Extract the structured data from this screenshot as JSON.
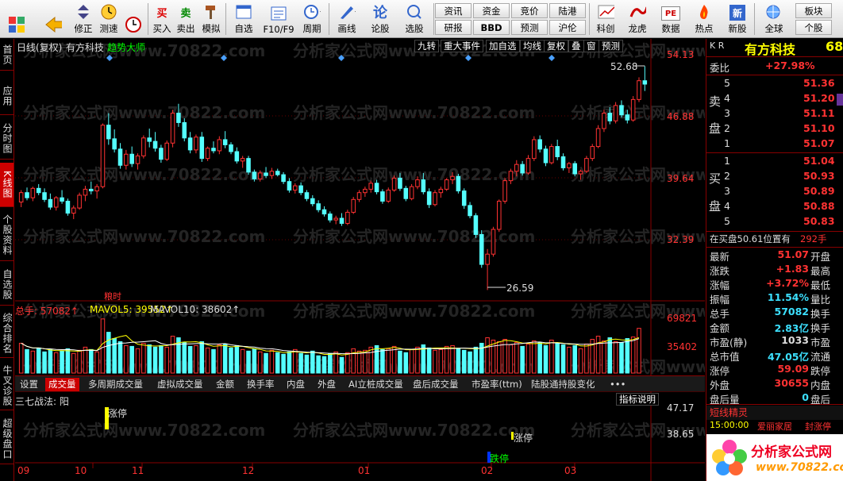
{
  "toolbar": {
    "buttons": [
      {
        "label": "",
        "icon": "grid-icon"
      },
      {
        "label": "",
        "icon": "back-arrow-icon"
      },
      {
        "label": "修正",
        "icon": "up-arrow-icon"
      },
      {
        "label": "测速",
        "icon": "clock-icon"
      },
      {
        "label": "买入",
        "icon": "buy-icon"
      },
      {
        "label": "卖出",
        "icon": "sell-icon"
      },
      {
        "label": "模拟",
        "icon": "hammer-icon"
      },
      {
        "label": "自选",
        "icon": "favorites-icon"
      },
      {
        "label": "F10/F9",
        "icon": "f10-icon"
      },
      {
        "label": "周期",
        "icon": "cycle-icon"
      },
      {
        "label": "画线",
        "icon": "pen-icon"
      },
      {
        "label": "论股",
        "icon": "discuss-icon"
      },
      {
        "label": "选股",
        "icon": "select-icon"
      },
      {
        "label": "科创",
        "icon": "kechuang-icon"
      },
      {
        "label": "龙虎",
        "icon": "dragon-icon"
      },
      {
        "label": "数据",
        "icon": "data-icon"
      },
      {
        "label": "热点",
        "icon": "hot-icon"
      },
      {
        "label": "新股",
        "icon": "ipo-icon"
      },
      {
        "label": "全球",
        "icon": "globe-icon"
      }
    ],
    "small_top": [
      "资讯",
      "资金",
      "竞价",
      "陆港",
      "板块"
    ],
    "small_bottom": [
      "研报",
      "BBD",
      "预测",
      "沪伦",
      "个股"
    ],
    "sell_glyph": "卖",
    "buy_glyph": "买",
    "lun_glyph": "论",
    "pe_glyph": "PE",
    "new_glyph": "新"
  },
  "sidebar": {
    "tabs": [
      "首页",
      "应用",
      "分时图",
      "K线图",
      "个股资料",
      "自选股",
      "综合排名",
      "牛叉诊股",
      "超级盘口"
    ]
  },
  "chart": {
    "period": "日线(复权)",
    "stock_name": "有方科技",
    "indicator": "趋势大师",
    "buttons": [
      "九转",
      "重大事件",
      "加自选",
      "均线",
      "复权",
      "叠",
      "窗",
      "预测"
    ],
    "price_labels": [
      "54.13",
      "46.88",
      "39.64",
      "32.39"
    ],
    "high_label": "52.68",
    "low_label": "26.59",
    "event_label": "粮时",
    "volume_header": {
      "total": "总手: 57082↑",
      "ma5": "MAVOL5: 39552↑",
      "ma10": "MAVOL10: 38602↑"
    },
    "volume_labels": [
      "69821",
      "35402"
    ],
    "tabs": [
      "设置",
      "成交量",
      "多周期成交量",
      "虚拟成交量",
      "金额",
      "换手率",
      "内盘",
      "外盘",
      "AI立桩成交量",
      "盘后成交量",
      "市盈率(ttm)",
      "陆股通持股变化",
      "•••"
    ],
    "indicator_button": "指标说明",
    "sub_title": "三七战法: 阳",
    "sub_labels": [
      "47.17",
      "38.65"
    ],
    "zt1": "涨停",
    "zt2": "涨停",
    "dt": "跌停",
    "months": [
      "09",
      "10",
      "11",
      "12",
      "01",
      "02",
      "03"
    ],
    "watermark": "分析家公式网www.70822.com"
  },
  "chart_data": {
    "type": "candlestick",
    "ylim": [
      26,
      55
    ],
    "candles": [
      [
        36.8,
        38.2,
        36.2,
        37.9
      ],
      [
        37.9,
        38.5,
        37.0,
        37.3
      ],
      [
        37.3,
        38.6,
        36.9,
        38.4
      ],
      [
        38.4,
        38.9,
        37.6,
        37.9
      ],
      [
        37.9,
        38.4,
        36.8,
        37.1
      ],
      [
        37.1,
        37.8,
        35.9,
        36.2
      ],
      [
        36.2,
        37.5,
        35.8,
        37.3
      ],
      [
        37.3,
        38.2,
        36.6,
        36.9
      ],
      [
        36.9,
        37.2,
        35.2,
        35.5
      ],
      [
        35.5,
        36.4,
        34.8,
        36.1
      ],
      [
        36.1,
        37.9,
        35.9,
        37.6
      ],
      [
        37.6,
        38.7,
        36.9,
        38.3
      ],
      [
        38.3,
        39.2,
        37.7,
        38.1
      ],
      [
        38.1,
        38.9,
        37.2,
        38.6
      ],
      [
        38.6,
        46.0,
        38.4,
        45.8
      ],
      [
        45.8,
        47.2,
        43.5,
        44.2
      ],
      [
        44.2,
        45.3,
        42.6,
        43.0
      ],
      [
        43.0,
        43.7,
        40.7,
        41.1
      ],
      [
        41.1,
        42.9,
        40.6,
        42.4
      ],
      [
        42.4,
        43.3,
        40.9,
        41.3
      ],
      [
        41.3,
        42.5,
        40.6,
        42.2
      ],
      [
        42.2,
        44.6,
        41.9,
        44.3
      ],
      [
        44.3,
        45.4,
        43.2,
        43.9
      ],
      [
        43.9,
        45.0,
        42.7,
        43.1
      ],
      [
        43.1,
        43.5,
        41.4,
        41.8
      ],
      [
        41.8,
        44.0,
        41.6,
        43.7
      ],
      [
        43.7,
        47.6,
        43.2,
        47.2
      ],
      [
        47.2,
        48.3,
        45.6,
        46.1
      ],
      [
        46.1,
        46.6,
        43.9,
        44.3
      ],
      [
        44.3,
        45.0,
        42.5,
        42.9
      ],
      [
        42.9,
        44.7,
        42.5,
        44.4
      ],
      [
        44.4,
        45.0,
        41.5,
        41.9
      ],
      [
        41.9,
        43.3,
        41.6,
        43.1
      ],
      [
        43.1,
        43.9,
        42.5,
        42.8
      ],
      [
        42.8,
        44.5,
        42.4,
        44.1
      ],
      [
        44.1,
        45.1,
        43.1,
        43.5
      ],
      [
        43.5,
        43.8,
        42.4,
        42.7
      ],
      [
        42.7,
        43.2,
        41.3,
        41.6
      ],
      [
        41.6,
        42.2,
        40.8,
        41.9
      ],
      [
        41.9,
        42.2,
        40.0,
        40.3
      ],
      [
        40.3,
        40.6,
        39.2,
        39.5
      ],
      [
        39.5,
        40.5,
        39.2,
        40.2
      ],
      [
        40.2,
        40.9,
        39.6,
        39.9
      ],
      [
        39.9,
        40.8,
        39.5,
        40.4
      ],
      [
        40.4,
        40.7,
        39.8,
        40.0
      ],
      [
        40.0,
        40.3,
        38.9,
        39.2
      ],
      [
        39.2,
        39.6,
        37.9,
        38.2
      ],
      [
        38.2,
        39.0,
        37.8,
        38.7
      ],
      [
        38.7,
        39.1,
        37.6,
        37.9
      ],
      [
        37.9,
        38.2,
        36.9,
        37.2
      ],
      [
        37.2,
        37.6,
        36.3,
        36.6
      ],
      [
        36.6,
        37.0,
        35.6,
        35.9
      ],
      [
        35.9,
        36.3,
        35.1,
        35.4
      ],
      [
        35.4,
        35.7,
        34.4,
        34.7
      ],
      [
        34.7,
        35.2,
        34.2,
        34.9
      ],
      [
        34.9,
        35.5,
        34.0,
        34.3
      ],
      [
        34.3,
        35.9,
        34.1,
        35.6
      ],
      [
        35.6,
        37.4,
        35.4,
        37.1
      ],
      [
        37.1,
        38.2,
        36.8,
        37.9
      ],
      [
        37.9,
        38.6,
        37.4,
        38.3
      ],
      [
        38.3,
        39.3,
        37.9,
        39.0
      ],
      [
        39.0,
        39.4,
        37.7,
        38.0
      ],
      [
        38.0,
        38.3,
        36.6,
        36.9
      ],
      [
        36.9,
        38.5,
        36.7,
        38.2
      ],
      [
        38.2,
        39.9,
        38.0,
        39.6
      ],
      [
        39.6,
        40.2,
        38.1,
        38.4
      ],
      [
        38.4,
        38.7,
        36.9,
        37.2
      ],
      [
        37.2,
        38.9,
        37.0,
        38.6
      ],
      [
        38.6,
        39.8,
        38.3,
        39.4
      ],
      [
        39.4,
        40.2,
        37.7,
        38.0
      ],
      [
        38.0,
        38.4,
        36.1,
        36.5
      ],
      [
        36.5,
        38.2,
        36.3,
        37.9
      ],
      [
        37.9,
        38.6,
        37.3,
        38.3
      ],
      [
        38.3,
        39.6,
        38.1,
        39.4
      ],
      [
        39.4,
        40.3,
        38.9,
        39.8
      ],
      [
        39.8,
        40.1,
        37.8,
        38.1
      ],
      [
        38.1,
        38.4,
        36.0,
        36.4
      ],
      [
        36.4,
        36.8,
        34.9,
        35.2
      ],
      [
        35.2,
        35.5,
        32.6,
        33.0
      ],
      [
        33.0,
        33.5,
        29.1,
        29.5
      ],
      [
        29.5,
        31.3,
        26.5,
        30.7
      ],
      [
        30.7,
        33.9,
        30.4,
        33.6
      ],
      [
        33.6,
        37.1,
        33.3,
        36.9
      ],
      [
        36.9,
        39.6,
        36.6,
        39.3
      ],
      [
        39.3,
        40.7,
        38.9,
        40.4
      ],
      [
        40.4,
        41.7,
        39.8,
        41.2
      ],
      [
        41.2,
        41.6,
        39.9,
        40.2
      ],
      [
        40.2,
        42.3,
        40.0,
        41.9
      ],
      [
        41.9,
        44.5,
        41.6,
        44.1
      ],
      [
        44.1,
        44.6,
        42.6,
        43.0
      ],
      [
        43.0,
        43.4,
        41.0,
        41.4
      ],
      [
        41.4,
        43.6,
        41.2,
        43.3
      ],
      [
        43.3,
        44.1,
        41.7,
        42.1
      ],
      [
        42.1,
        42.5,
        40.5,
        40.8
      ],
      [
        40.8,
        41.5,
        40.2,
        41.3
      ],
      [
        41.3,
        41.6,
        39.8,
        40.1
      ],
      [
        40.1,
        40.6,
        39.4,
        40.4
      ],
      [
        40.4,
        42.2,
        40.2,
        41.9
      ],
      [
        41.9,
        43.6,
        41.6,
        43.3
      ],
      [
        43.3,
        45.8,
        43.1,
        45.4
      ],
      [
        45.4,
        47.6,
        45.0,
        47.2
      ],
      [
        47.2,
        47.9,
        45.9,
        46.3
      ],
      [
        46.3,
        48.5,
        46.0,
        48.1
      ],
      [
        48.1,
        48.7,
        46.7,
        47.0
      ],
      [
        47.0,
        47.6,
        46.0,
        46.4
      ],
      [
        46.4,
        49.2,
        46.2,
        48.8
      ],
      [
        48.8,
        51.4,
        48.5,
        51.0
      ],
      [
        51.0,
        52.7,
        49.8,
        50.6
      ]
    ],
    "volume": [
      38,
      30,
      28,
      32,
      27,
      30,
      26,
      28,
      31,
      25,
      29,
      33,
      30,
      27,
      69,
      52,
      44,
      40,
      35,
      34,
      31,
      38,
      36,
      33,
      35,
      33,
      47,
      45,
      39,
      34,
      35,
      40,
      32,
      30,
      36,
      37,
      32,
      35,
      30,
      28,
      31,
      27,
      25,
      29,
      26,
      24,
      27,
      30,
      25,
      23,
      28,
      22,
      21,
      25,
      27,
      20,
      26,
      31,
      28,
      29,
      33,
      35,
      30,
      31,
      34,
      28,
      26,
      30,
      33,
      36,
      32,
      29,
      30,
      34,
      35,
      31,
      29,
      27,
      33,
      38,
      45,
      42,
      40,
      43,
      36,
      39,
      34,
      37,
      41,
      39,
      35,
      42,
      38,
      36,
      33,
      35,
      31,
      37,
      43,
      47,
      41,
      45,
      40,
      39,
      44,
      46,
      57
    ]
  },
  "panel": {
    "title_prefix": "K R",
    "name": "有方科技",
    "code": "68",
    "webi_label": "委比",
    "webi_value": "+27.98%",
    "sell_label": "卖",
    "pan_label": "盘",
    "buy_label": "买",
    "sells": [
      [
        "5",
        "51.36"
      ],
      [
        "4",
        "51.20"
      ],
      [
        "3",
        "51.11"
      ],
      [
        "2",
        "51.10"
      ],
      [
        "1",
        "51.07"
      ]
    ],
    "buys": [
      [
        "1",
        "51.04"
      ],
      [
        "2",
        "50.93"
      ],
      [
        "3",
        "50.89"
      ],
      [
        "4",
        "50.88"
      ],
      [
        "5",
        "50.83"
      ]
    ],
    "position_text": "在买盘50.61位置有",
    "position_qty": "292手",
    "stats": [
      [
        "最新",
        "51.07",
        "开盘"
      ],
      [
        "涨跌",
        "+1.83",
        "最高"
      ],
      [
        "涨幅",
        "+3.72%",
        "最低"
      ],
      [
        "振幅",
        "11.54%",
        "量比"
      ],
      [
        "总手",
        "57082",
        "换手"
      ],
      [
        "金额",
        "2.83亿",
        "换手"
      ],
      [
        "市盈(静)",
        "1033",
        "市盈"
      ],
      [
        "总市值",
        "47.05亿",
        "流通"
      ],
      [
        "涨停",
        "59.09",
        "跌停"
      ],
      [
        "外盘",
        "30655",
        "内盘"
      ],
      [
        "盘后量",
        "0",
        "盘后"
      ]
    ],
    "genie_title": "短线精灵",
    "genie_time": "15:00:00",
    "genie_text": "爱丽家居",
    "genie_extra": "封涨停",
    "logo_text": "分析家公式网",
    "logo_url": "www.70822.com"
  }
}
